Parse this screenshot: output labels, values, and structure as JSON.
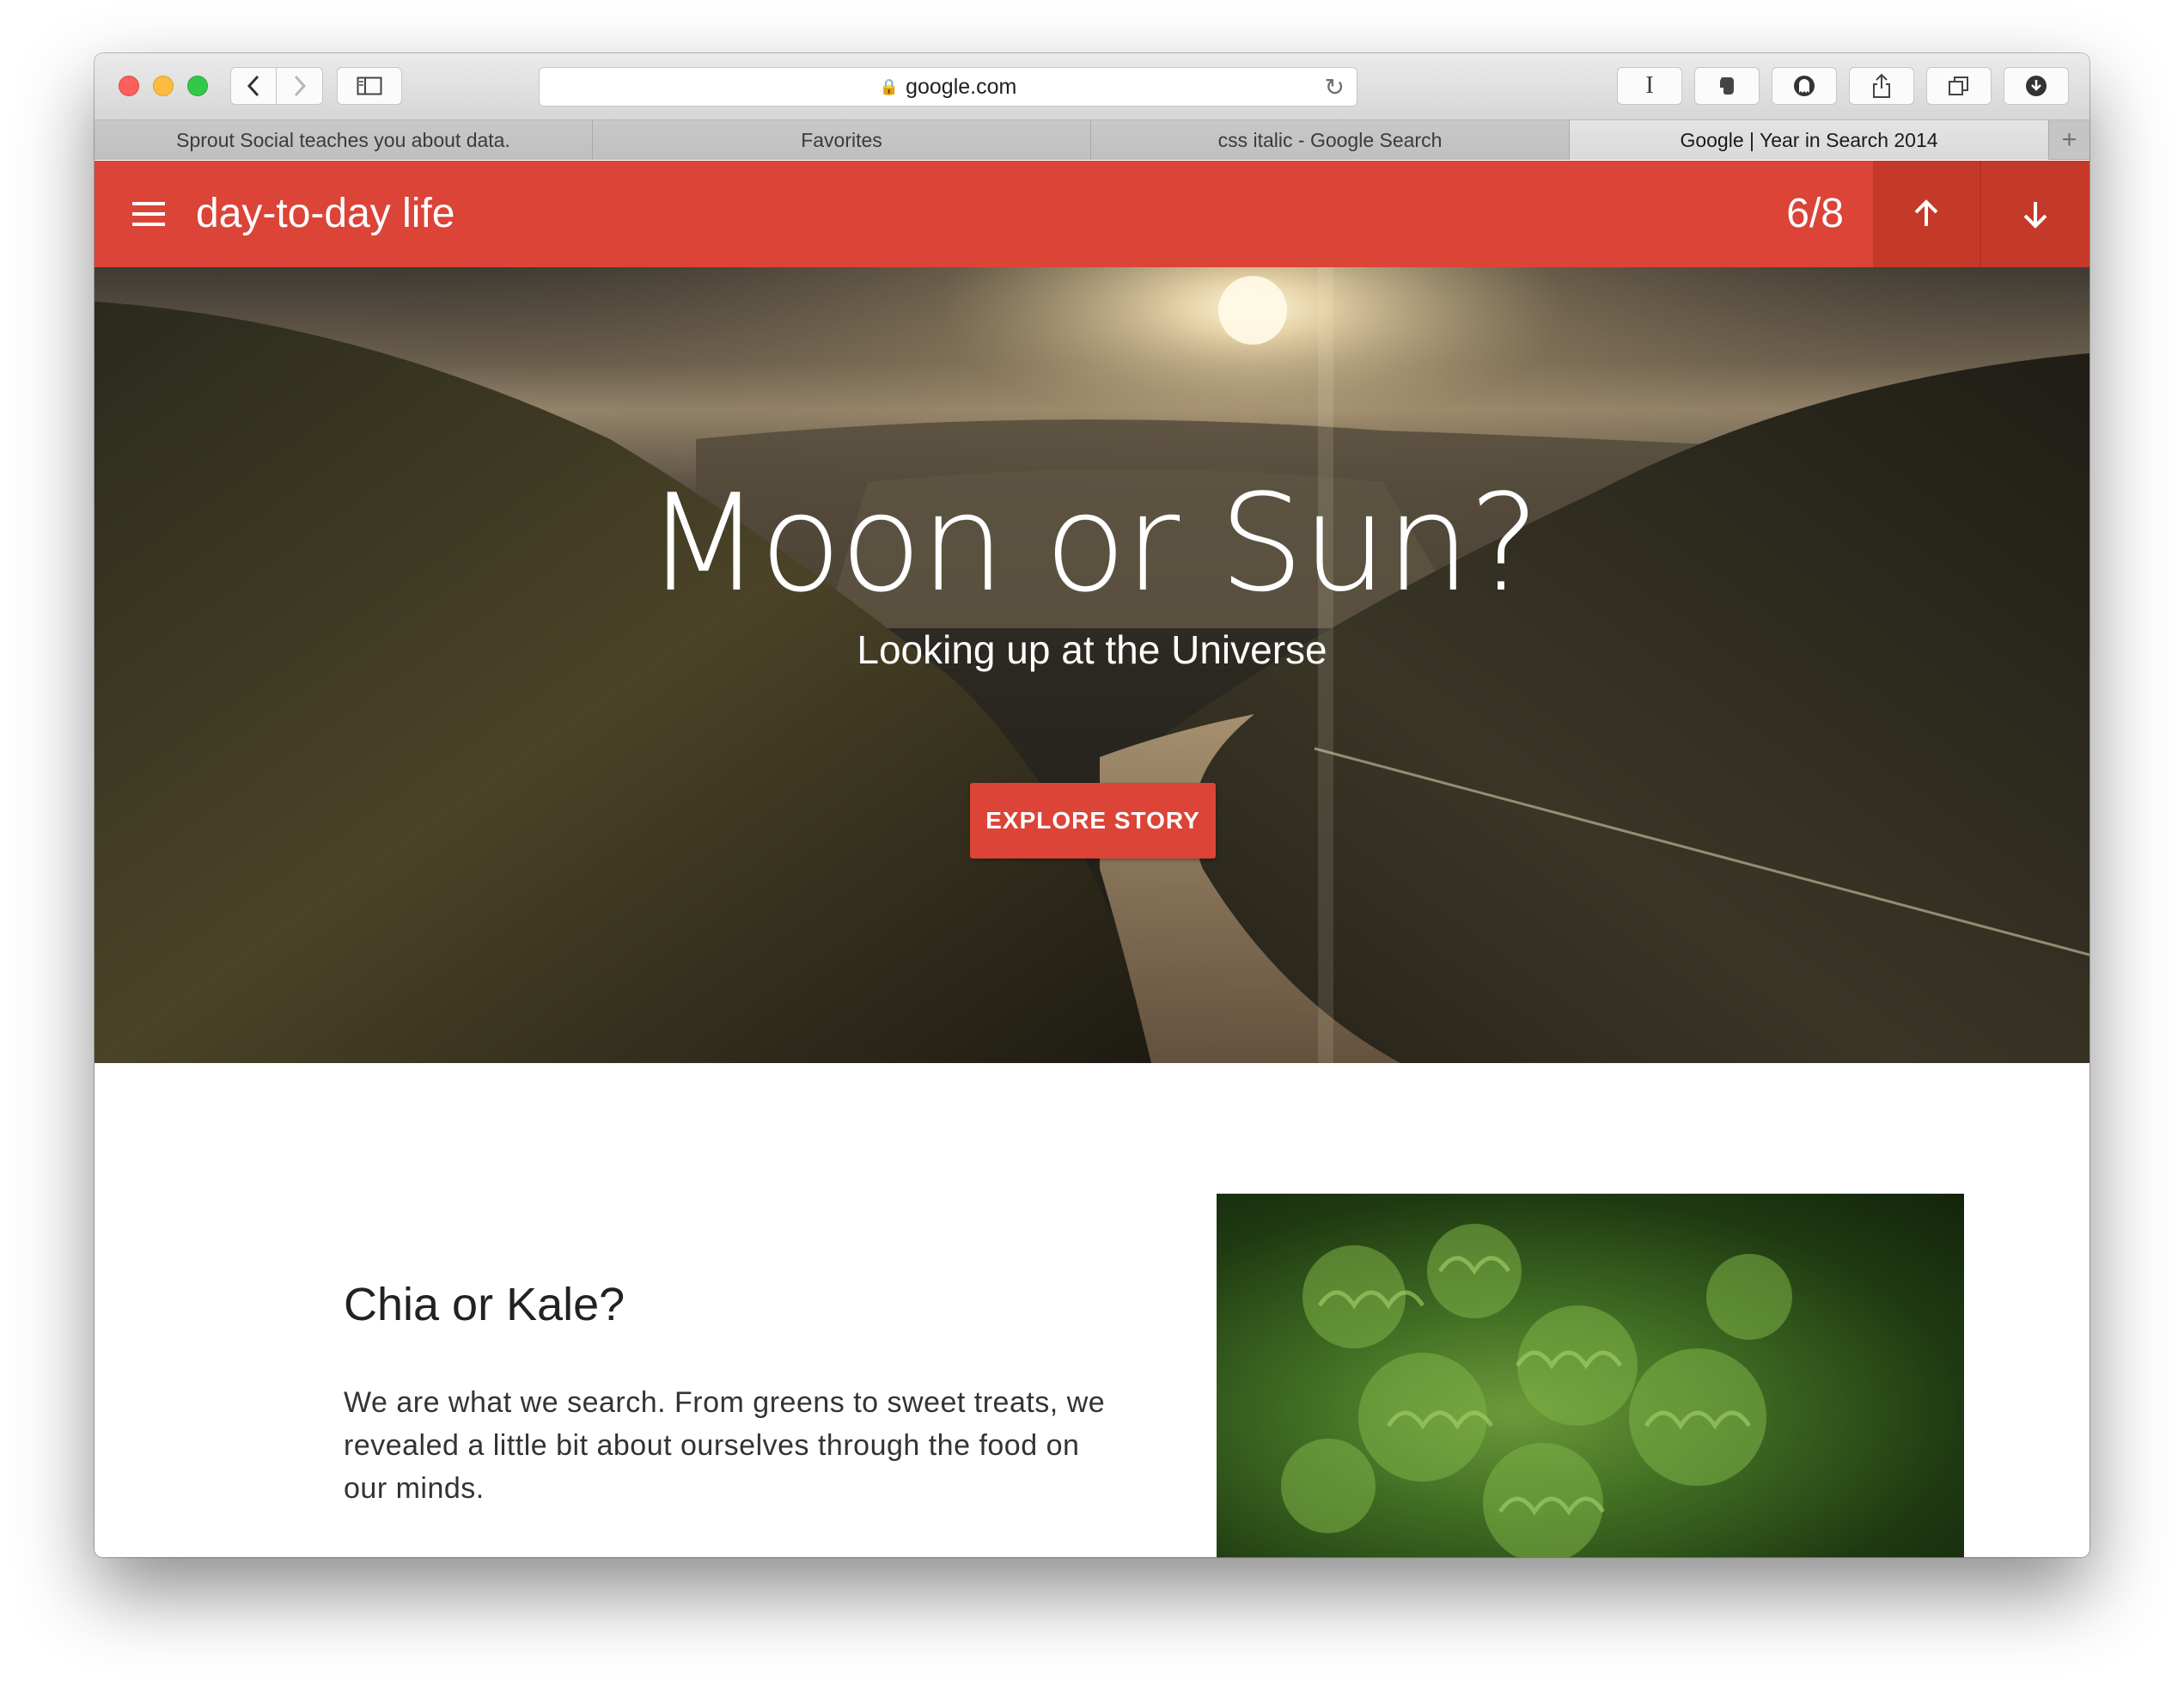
{
  "browser": {
    "url": "google.com",
    "tabs": [
      {
        "label": "Sprout Social teaches you about data."
      },
      {
        "label": "Favorites"
      },
      {
        "label": "css italic - Google Search"
      },
      {
        "label": "Google | Year in Search 2014",
        "active": true
      }
    ]
  },
  "appbar": {
    "title": "day-to-day life",
    "counter": "6/8",
    "color": "#db4437"
  },
  "hero": {
    "title": "Moon or Sun?",
    "subtitle": "Looking up at the Universe",
    "button_label": "EXPLORE STORY"
  },
  "section": {
    "title": "Chia or Kale?",
    "body": "We are what we search. From greens to sweet treats, we revealed a little bit about ourselves through the food on our minds."
  }
}
